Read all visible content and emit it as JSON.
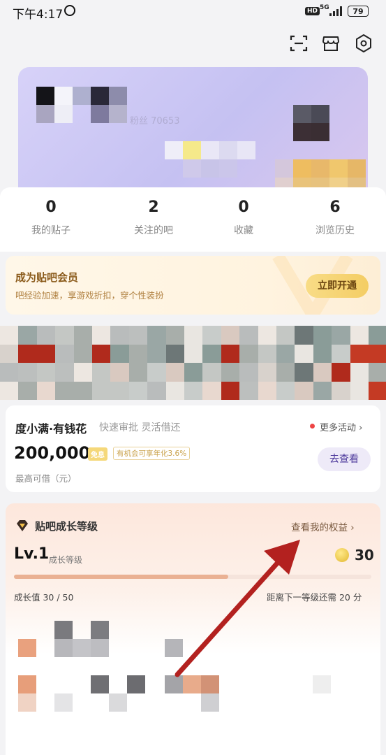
{
  "status_bar": {
    "time": "下午4:17",
    "hd": "HD",
    "network": "5G",
    "battery": "79"
  },
  "header": {
    "icons": [
      "scan-icon",
      "shop-icon",
      "settings-icon"
    ]
  },
  "profile": {
    "fans_text": "粉丝 70653"
  },
  "stats": [
    {
      "value": "0",
      "label": "我的贴子"
    },
    {
      "value": "2",
      "label": "关注的吧"
    },
    {
      "value": "0",
      "label": "收藏"
    },
    {
      "value": "6",
      "label": "浏览历史"
    }
  ],
  "vip": {
    "title": "成为贴吧会员",
    "subtitle": "吧经验加速，享游戏折扣，穿个性装扮",
    "button": "立即开通"
  },
  "loan": {
    "brand": "度小满·有钱花",
    "tags": "快速审批  灵活借还",
    "more": "更多活动",
    "amount": "200,000",
    "free_badge": "免息",
    "rate_text": "有机会可享年化3.6%",
    "amount_label": "最高可借（元）",
    "button": "去查看"
  },
  "growth": {
    "title": "贴吧成长等级",
    "link": "查看我的权益",
    "level": "Lv.1",
    "level_label": "成长等级",
    "coins": "30",
    "progress_fraction": 0.6,
    "value_text": "成长值 30 / 50",
    "need_text": "距离下一等级还需 20 分"
  },
  "colors": {
    "accent_purple": "#4e3a9c",
    "vip_gold": "#f4cd64",
    "arrow_red": "#b3211f"
  }
}
